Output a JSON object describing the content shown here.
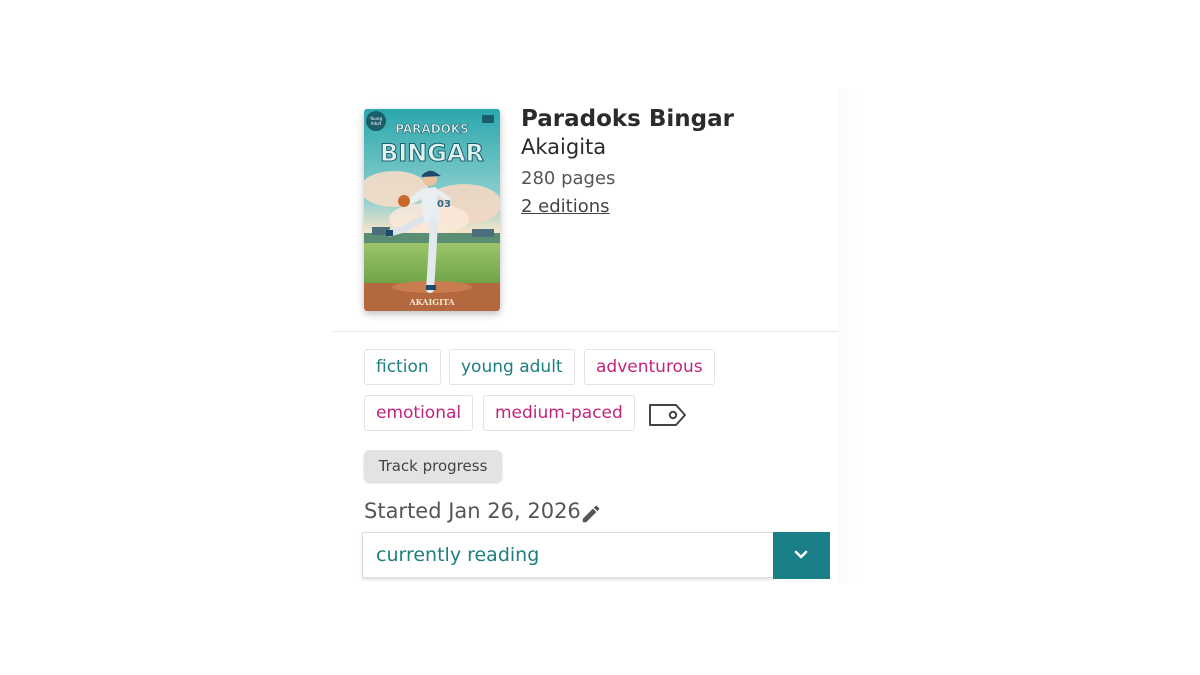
{
  "book": {
    "title": "Paradoks Bingar",
    "author": "Akaigita",
    "pages": "280 pages",
    "editions": "2 editions",
    "cover": {
      "series_badge": "Young Adult",
      "title_line1": "PARADOKS",
      "title_line2": "BINGAR",
      "author": "AKAIGITA"
    }
  },
  "tags": [
    {
      "label": "fiction",
      "color": "#1e7f80"
    },
    {
      "label": "young adult",
      "color": "#1e7f80"
    },
    {
      "label": "adventurous",
      "color": "#c2247c"
    },
    {
      "label": "emotional",
      "color": "#c2247c"
    },
    {
      "label": "medium-paced",
      "color": "#c2247c"
    }
  ],
  "tag_icon": "tag-outline-icon",
  "track_progress_label": "Track progress",
  "started": {
    "text": "Started Jan 26, 2026",
    "edit_icon": "pencil-icon"
  },
  "status": {
    "selected": "currently reading",
    "toggle_icon": "chevron-down-icon",
    "accent": "#1a7f86"
  }
}
